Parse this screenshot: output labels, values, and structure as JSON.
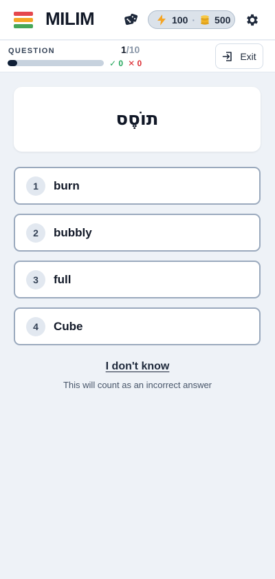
{
  "header": {
    "brand": "MILIM",
    "menu_colors": [
      "#e5484d",
      "#f5a524",
      "#46a758"
    ],
    "energy": "100",
    "separator": "·",
    "coins": "500"
  },
  "progress": {
    "label": "QUESTION",
    "current": "1",
    "separator": "/",
    "total": "10",
    "fraction": 0.1,
    "correct_mark": "✓",
    "correct_count": "0",
    "wrong_mark": "✕",
    "wrong_count": "0"
  },
  "exit_label": "Exit",
  "question": {
    "word": "תוֹסֶס"
  },
  "options": [
    {
      "number": "1",
      "label": "burn"
    },
    {
      "number": "2",
      "label": "bubbly"
    },
    {
      "number": "3",
      "label": "full"
    },
    {
      "number": "4",
      "label": "Cube"
    }
  ],
  "dont_know": {
    "label": "I don't know",
    "note": "This will count as an incorrect answer"
  }
}
